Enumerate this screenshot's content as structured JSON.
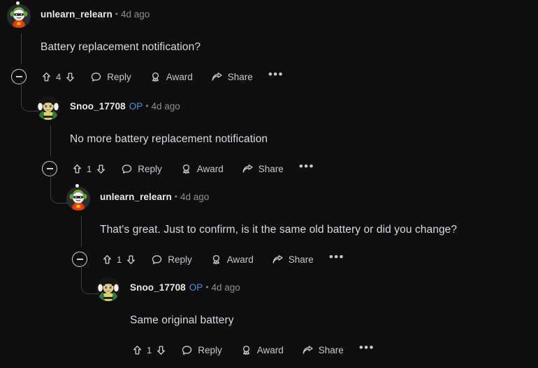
{
  "theme": {
    "background": "#0e0e0f",
    "body_text": "#d6dce2",
    "username": "#e8eaed",
    "muted": "#8b8f94",
    "op_badge": "#4a8fe7",
    "thread_line": "#3d3f42",
    "icon": "#c3c9d0"
  },
  "labels": {
    "reply": "Reply",
    "award": "Award",
    "share": "Share",
    "more": "•••",
    "op": "OP",
    "separator": "•"
  },
  "comments": [
    {
      "id": "c1",
      "depth": 0,
      "author": "unlearn_relearn",
      "is_op": false,
      "timestamp": "4d ago",
      "body": "Battery replacement notification?",
      "score": "4",
      "has_collapse": true,
      "online": true,
      "avatar": "snoo-green-headphones"
    },
    {
      "id": "c2",
      "depth": 1,
      "author": "Snoo_17708",
      "is_op": true,
      "timestamp": "4d ago",
      "body": "No more battery replacement notification",
      "score": "1",
      "has_collapse": true,
      "online": false,
      "avatar": "snoo-dark-hair-olive"
    },
    {
      "id": "c3",
      "depth": 2,
      "author": "unlearn_relearn",
      "is_op": false,
      "timestamp": "4d ago",
      "body": "That's great. Just to confirm, is it the same old battery or did you change?",
      "score": "1",
      "has_collapse": true,
      "online": true,
      "avatar": "snoo-green-headphones"
    },
    {
      "id": "c4",
      "depth": 3,
      "author": "Snoo_17708",
      "is_op": true,
      "timestamp": "4d ago",
      "body": "Same original battery",
      "score": "1",
      "has_collapse": false,
      "online": false,
      "avatar": "snoo-dark-hair-olive"
    }
  ]
}
